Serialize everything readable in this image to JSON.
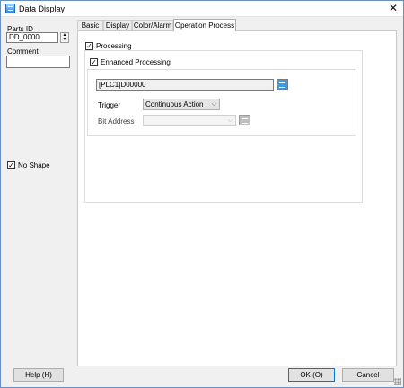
{
  "window": {
    "title": "Data Display",
    "close_symbol": "✕"
  },
  "left": {
    "parts_id_label": "Parts ID",
    "parts_id_value": "DD_0000",
    "spinner_up": "▲",
    "spinner_down": "▼",
    "comment_label": "Comment",
    "comment_value": "",
    "no_shape_label": "No Shape",
    "no_shape_checked": "✓"
  },
  "tabs": [
    {
      "label": "Basic"
    },
    {
      "label": "Display"
    },
    {
      "label": "Color/Alarm"
    },
    {
      "label": "Operation Process"
    }
  ],
  "process": {
    "processing_label": "Processing",
    "processing_checked": "✓",
    "enhanced_label": "Enhanced Processing",
    "enhanced_checked": "✓",
    "address_value": "[PLC1]D00000",
    "trigger_label": "Trigger",
    "trigger_value": "Continuous Action",
    "bit_address_label": "Bit Address",
    "bit_address_value": "",
    "dropdown_arrow": "⌵"
  },
  "footer": {
    "help_label": "Help (H)",
    "ok_label": "OK (O)",
    "cancel_label": "Cancel"
  },
  "colors": {
    "accent": "#0078d7",
    "tag_button": "#3d9ce0"
  }
}
